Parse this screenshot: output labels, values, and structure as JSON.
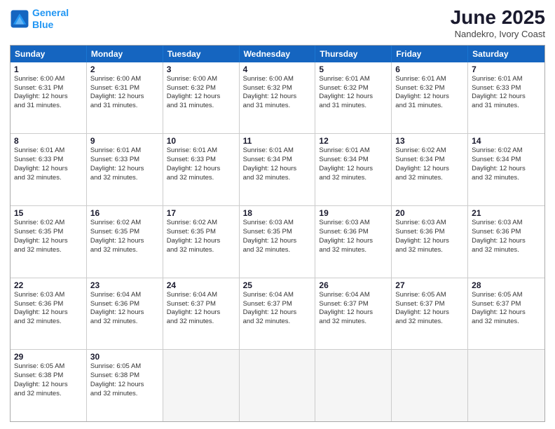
{
  "logo": {
    "line1": "General",
    "line2": "Blue"
  },
  "title": "June 2025",
  "subtitle": "Nandekro, Ivory Coast",
  "days_of_week": [
    "Sunday",
    "Monday",
    "Tuesday",
    "Wednesday",
    "Thursday",
    "Friday",
    "Saturday"
  ],
  "weeks": [
    [
      {
        "day": "1",
        "info": "Sunrise: 6:00 AM\nSunset: 6:31 PM\nDaylight: 12 hours\nand 31 minutes."
      },
      {
        "day": "2",
        "info": "Sunrise: 6:00 AM\nSunset: 6:31 PM\nDaylight: 12 hours\nand 31 minutes."
      },
      {
        "day": "3",
        "info": "Sunrise: 6:00 AM\nSunset: 6:32 PM\nDaylight: 12 hours\nand 31 minutes."
      },
      {
        "day": "4",
        "info": "Sunrise: 6:00 AM\nSunset: 6:32 PM\nDaylight: 12 hours\nand 31 minutes."
      },
      {
        "day": "5",
        "info": "Sunrise: 6:01 AM\nSunset: 6:32 PM\nDaylight: 12 hours\nand 31 minutes."
      },
      {
        "day": "6",
        "info": "Sunrise: 6:01 AM\nSunset: 6:32 PM\nDaylight: 12 hours\nand 31 minutes."
      },
      {
        "day": "7",
        "info": "Sunrise: 6:01 AM\nSunset: 6:33 PM\nDaylight: 12 hours\nand 31 minutes."
      }
    ],
    [
      {
        "day": "8",
        "info": "Sunrise: 6:01 AM\nSunset: 6:33 PM\nDaylight: 12 hours\nand 32 minutes."
      },
      {
        "day": "9",
        "info": "Sunrise: 6:01 AM\nSunset: 6:33 PM\nDaylight: 12 hours\nand 32 minutes."
      },
      {
        "day": "10",
        "info": "Sunrise: 6:01 AM\nSunset: 6:33 PM\nDaylight: 12 hours\nand 32 minutes."
      },
      {
        "day": "11",
        "info": "Sunrise: 6:01 AM\nSunset: 6:34 PM\nDaylight: 12 hours\nand 32 minutes."
      },
      {
        "day": "12",
        "info": "Sunrise: 6:01 AM\nSunset: 6:34 PM\nDaylight: 12 hours\nand 32 minutes."
      },
      {
        "day": "13",
        "info": "Sunrise: 6:02 AM\nSunset: 6:34 PM\nDaylight: 12 hours\nand 32 minutes."
      },
      {
        "day": "14",
        "info": "Sunrise: 6:02 AM\nSunset: 6:34 PM\nDaylight: 12 hours\nand 32 minutes."
      }
    ],
    [
      {
        "day": "15",
        "info": "Sunrise: 6:02 AM\nSunset: 6:35 PM\nDaylight: 12 hours\nand 32 minutes."
      },
      {
        "day": "16",
        "info": "Sunrise: 6:02 AM\nSunset: 6:35 PM\nDaylight: 12 hours\nand 32 minutes."
      },
      {
        "day": "17",
        "info": "Sunrise: 6:02 AM\nSunset: 6:35 PM\nDaylight: 12 hours\nand 32 minutes."
      },
      {
        "day": "18",
        "info": "Sunrise: 6:03 AM\nSunset: 6:35 PM\nDaylight: 12 hours\nand 32 minutes."
      },
      {
        "day": "19",
        "info": "Sunrise: 6:03 AM\nSunset: 6:36 PM\nDaylight: 12 hours\nand 32 minutes."
      },
      {
        "day": "20",
        "info": "Sunrise: 6:03 AM\nSunset: 6:36 PM\nDaylight: 12 hours\nand 32 minutes."
      },
      {
        "day": "21",
        "info": "Sunrise: 6:03 AM\nSunset: 6:36 PM\nDaylight: 12 hours\nand 32 minutes."
      }
    ],
    [
      {
        "day": "22",
        "info": "Sunrise: 6:03 AM\nSunset: 6:36 PM\nDaylight: 12 hours\nand 32 minutes."
      },
      {
        "day": "23",
        "info": "Sunrise: 6:04 AM\nSunset: 6:36 PM\nDaylight: 12 hours\nand 32 minutes."
      },
      {
        "day": "24",
        "info": "Sunrise: 6:04 AM\nSunset: 6:37 PM\nDaylight: 12 hours\nand 32 minutes."
      },
      {
        "day": "25",
        "info": "Sunrise: 6:04 AM\nSunset: 6:37 PM\nDaylight: 12 hours\nand 32 minutes."
      },
      {
        "day": "26",
        "info": "Sunrise: 6:04 AM\nSunset: 6:37 PM\nDaylight: 12 hours\nand 32 minutes."
      },
      {
        "day": "27",
        "info": "Sunrise: 6:05 AM\nSunset: 6:37 PM\nDaylight: 12 hours\nand 32 minutes."
      },
      {
        "day": "28",
        "info": "Sunrise: 6:05 AM\nSunset: 6:37 PM\nDaylight: 12 hours\nand 32 minutes."
      }
    ],
    [
      {
        "day": "29",
        "info": "Sunrise: 6:05 AM\nSunset: 6:38 PM\nDaylight: 12 hours\nand 32 minutes."
      },
      {
        "day": "30",
        "info": "Sunrise: 6:05 AM\nSunset: 6:38 PM\nDaylight: 12 hours\nand 32 minutes."
      },
      {
        "day": "",
        "info": ""
      },
      {
        "day": "",
        "info": ""
      },
      {
        "day": "",
        "info": ""
      },
      {
        "day": "",
        "info": ""
      },
      {
        "day": "",
        "info": ""
      }
    ]
  ]
}
